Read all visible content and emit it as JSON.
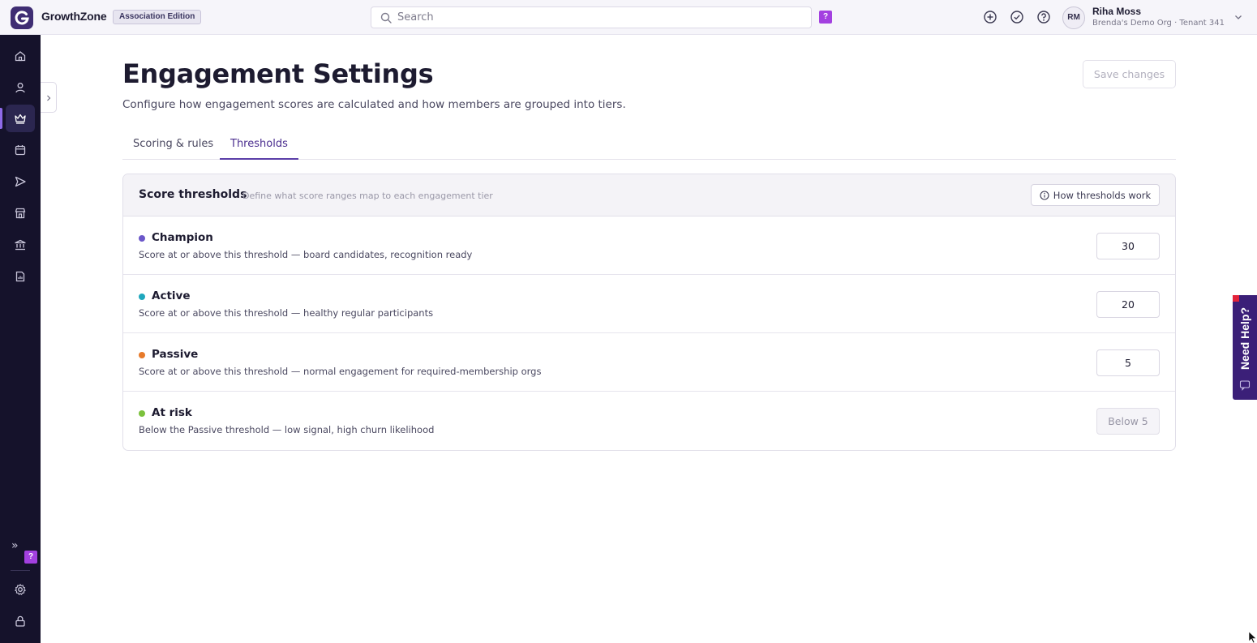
{
  "header": {
    "brand": "GrowthZone",
    "edition": "Association Edition",
    "search_placeholder": "Search",
    "help_badge": "?",
    "user": {
      "initials": "RM",
      "name": "Riha Moss",
      "org": "Brenda's Demo Org · Tenant 341"
    }
  },
  "sidebar": {
    "items": [
      "home-icon",
      "person-icon",
      "crown-icon",
      "calendar-icon",
      "send-icon",
      "store-icon",
      "bank-icon",
      "report-icon"
    ],
    "active_index": 2,
    "expand": "»",
    "badge": "?",
    "bottom_items": [
      "gear-icon",
      "lock-icon"
    ]
  },
  "page": {
    "title": "Engagement Settings",
    "subtitle": "Configure how engagement scores are calculated and how members are grouped into tiers.",
    "save_label": "Save changes",
    "tabs": [
      {
        "label": "Scoring & rules",
        "active": false
      },
      {
        "label": "Thresholds",
        "active": true
      }
    ]
  },
  "thresholds": {
    "title": "Score thresholds",
    "description": "Define what score ranges map to each engagement tier",
    "how_label": "How thresholds work",
    "tiers": [
      {
        "name": "Champion",
        "description": "Score at or above this threshold — board candidates, recognition ready",
        "value": "30",
        "color": "#6b57c9"
      },
      {
        "name": "Active",
        "description": "Score at or above this threshold — healthy regular participants",
        "value": "20",
        "color": "#1fa7bd"
      },
      {
        "name": "Passive",
        "description": "Score at or above this threshold — normal engagement for required-membership orgs",
        "value": "5",
        "color": "#e77a2a"
      },
      {
        "name": "At risk",
        "description": "Below the Passive threshold — low signal, high churn likelihood",
        "value": "Below 5",
        "color": "#7bc13c"
      }
    ]
  },
  "help_widget": {
    "label": "Need Help?"
  }
}
